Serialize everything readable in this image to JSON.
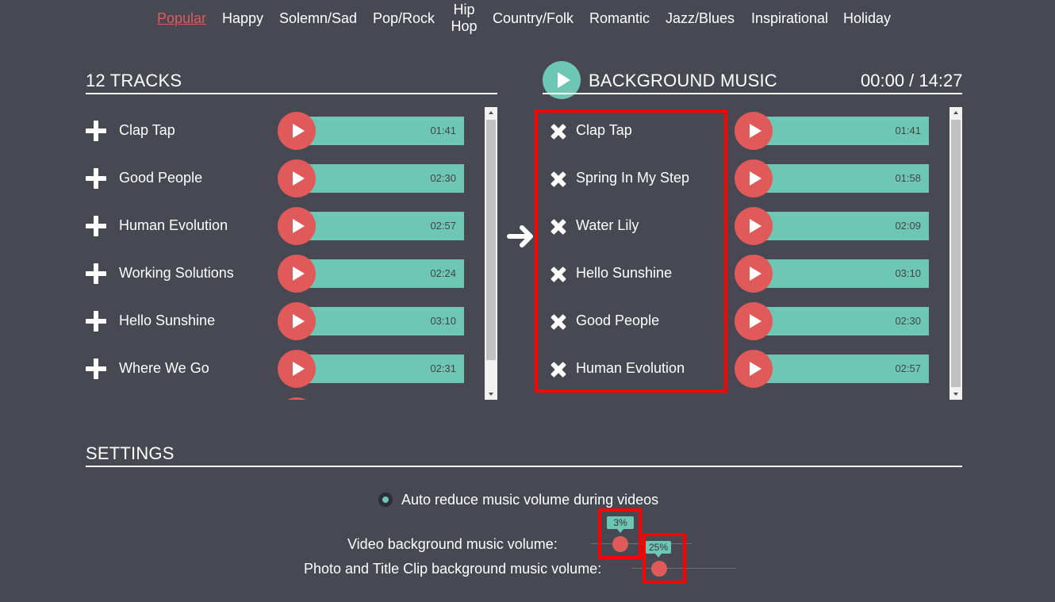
{
  "nav": {
    "genres": [
      "Popular",
      "Happy",
      "Solemn/Sad",
      "Pop/Rock",
      "Hip",
      "Hop",
      "Country/Folk",
      "Romantic",
      "Jazz/Blues",
      "Inspirational",
      "Holiday"
    ]
  },
  "library": {
    "title": "12 TRACKS",
    "tracks": [
      {
        "name": "Clap Tap",
        "duration": "01:41"
      },
      {
        "name": "Good People",
        "duration": "02:30"
      },
      {
        "name": "Human Evolution",
        "duration": "02:57"
      },
      {
        "name": "Working Solutions",
        "duration": "02:24"
      },
      {
        "name": "Hello Sunshine",
        "duration": "03:10"
      },
      {
        "name": "Where We Go",
        "duration": "02:31"
      }
    ]
  },
  "background": {
    "title": "BACKGROUND MUSIC",
    "time": "00:00 / 14:27",
    "tracks": [
      {
        "name": "Clap Tap",
        "duration": "01:41"
      },
      {
        "name": "Spring In My Step",
        "duration": "01:58"
      },
      {
        "name": "Water Lily",
        "duration": "02:09"
      },
      {
        "name": "Hello Sunshine",
        "duration": "03:10"
      },
      {
        "name": "Good People",
        "duration": "02:30"
      },
      {
        "name": "Human Evolution",
        "duration": "02:57"
      }
    ]
  },
  "settings": {
    "title": "SETTINGS",
    "auto_reduce_label": "Auto reduce music volume during videos",
    "video_volume_label": "Video background music volume:",
    "video_volume_value": "3%",
    "photo_volume_label": "Photo and Title Clip background music volume:",
    "photo_volume_value": "25%"
  },
  "colors": {
    "background": "#474851",
    "accent_teal": "#6ec7b4",
    "accent_red": "#e05a5a",
    "highlight": "#ff0000"
  }
}
